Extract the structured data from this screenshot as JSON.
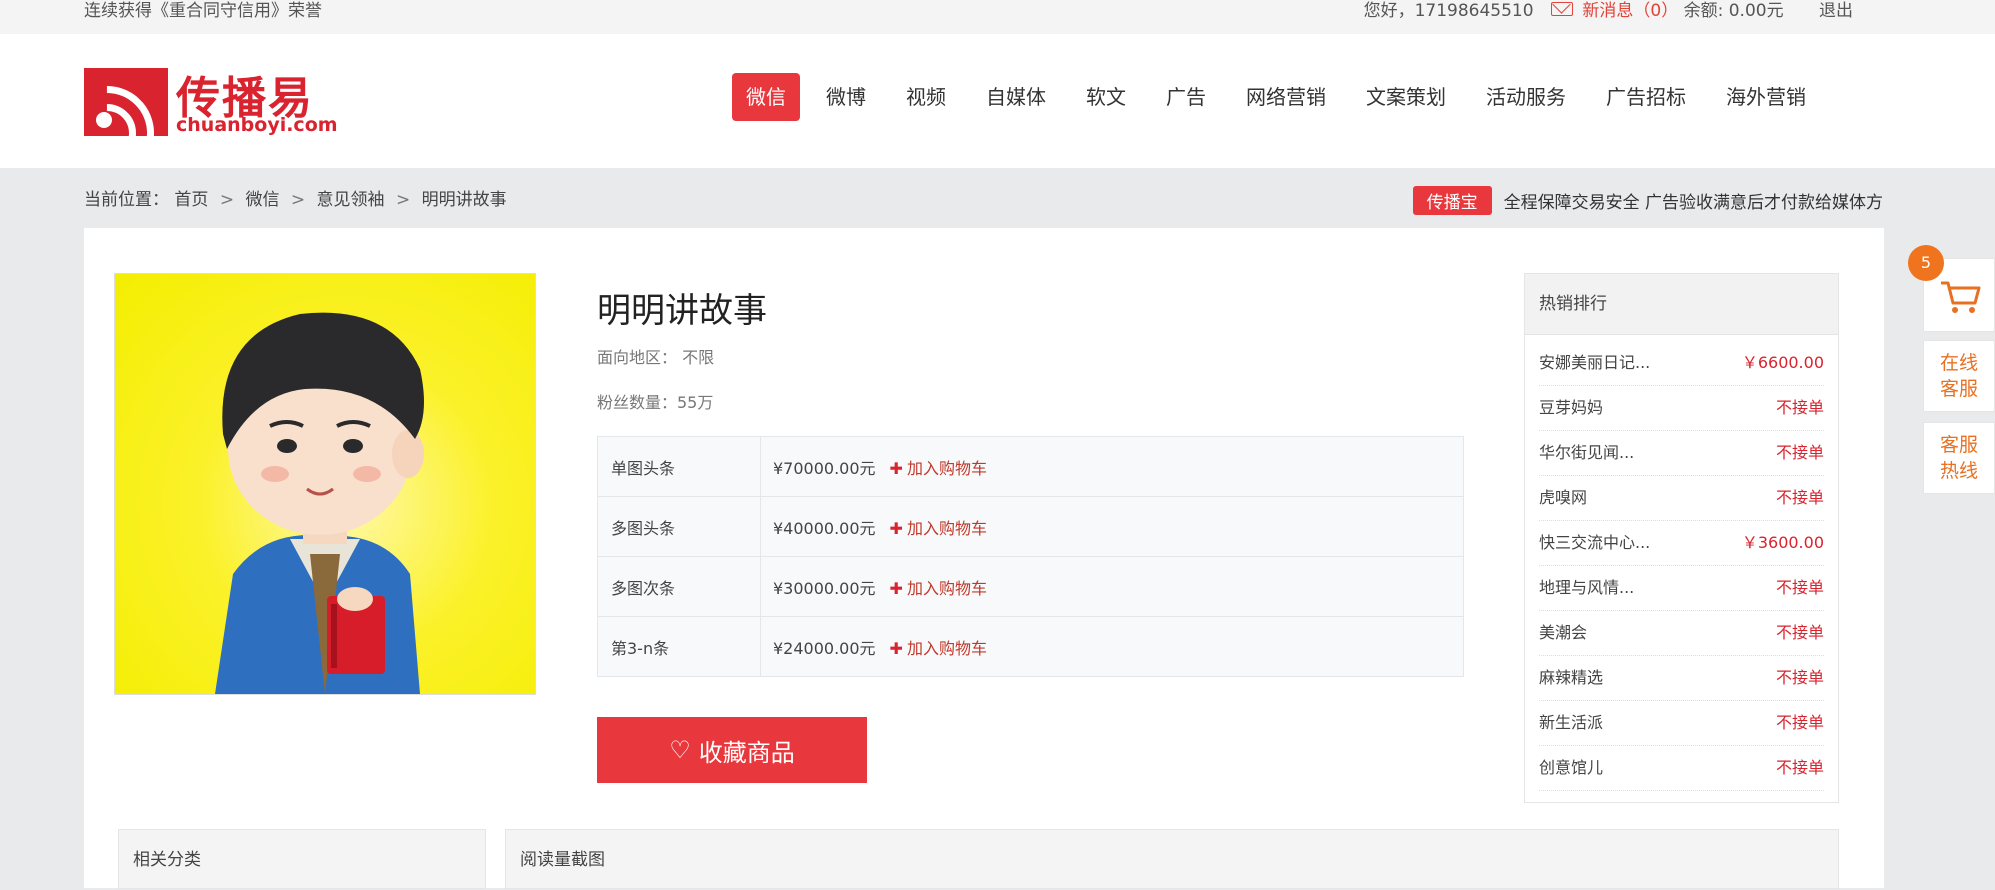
{
  "topbar": {
    "honor": "连续获得《重合同守信用》荣誉",
    "greeting": "您好，17198645510",
    "messages": "新消息（0）",
    "balance": "余额: 0.00元",
    "logout": "退出"
  },
  "logo": {
    "cn": "传播易",
    "en": "chuanboyi.com"
  },
  "nav": [
    "微信",
    "微博",
    "视频",
    "自媒体",
    "软文",
    "广告",
    "网络营销",
    "文案策划",
    "活动服务",
    "广告招标",
    "海外营销"
  ],
  "breadcrumb": {
    "label": "当前位置：",
    "items": [
      "首页",
      "微信",
      "意见领袖",
      "明明讲故事"
    ],
    "separator": ">"
  },
  "guarantee": {
    "badge": "传播宝",
    "text": "全程保障交易安全 广告验收满意后才付款给媒体方"
  },
  "product": {
    "title": "明明讲故事",
    "region": "面向地区： 不限",
    "fans": "粉丝数量：55万",
    "prices": [
      {
        "position": "单图头条",
        "price": "¥70000.00元",
        "add": "加入购物车"
      },
      {
        "position": "多图头条",
        "price": "¥40000.00元",
        "add": "加入购物车"
      },
      {
        "position": "多图次条",
        "price": "¥30000.00元",
        "add": "加入购物车"
      },
      {
        "position": "第3-n条",
        "price": "¥24000.00元",
        "add": "加入购物车"
      }
    ],
    "favorite": "收藏商品"
  },
  "hot": {
    "title": "热销排行",
    "items": [
      {
        "name": "安娜美丽日记...",
        "price": "￥6600.00"
      },
      {
        "name": "豆芽妈妈",
        "price": "不接单"
      },
      {
        "name": "华尔街见闻...",
        "price": "不接单"
      },
      {
        "name": "虎嗅网",
        "price": "不接单"
      },
      {
        "name": "快三交流中心...",
        "price": "￥3600.00"
      },
      {
        "name": "地理与风情...",
        "price": "不接单"
      },
      {
        "name": "美潮会",
        "price": "不接单"
      },
      {
        "name": "麻辣精选",
        "price": "不接单"
      },
      {
        "name": "新生活派",
        "price": "不接单"
      },
      {
        "name": "创意馆儿",
        "price": "不接单"
      }
    ]
  },
  "panels": {
    "related": "相关分类",
    "screenshots": "阅读量截图"
  },
  "float": {
    "cart_count": "5",
    "online_l1": "在线",
    "online_l2": "客服",
    "hotline_l1": "客服",
    "hotline_l2": "热线"
  },
  "colors": {
    "brand_red": "#d9232e",
    "accent_red": "#e8383d",
    "orange": "#f0731d"
  }
}
